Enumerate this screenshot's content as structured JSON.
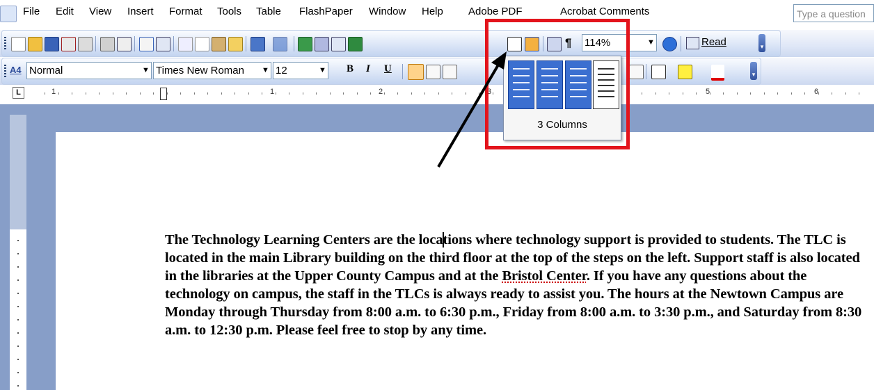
{
  "menubar": {
    "items": [
      "File",
      "Edit",
      "View",
      "Insert",
      "Format",
      "Tools",
      "Table",
      "FlashPaper",
      "Window",
      "Help",
      "Adobe PDF",
      "Acrobat Comments"
    ],
    "help_placeholder": "Type a question"
  },
  "formatting": {
    "style": "Normal",
    "font": "Times New Roman",
    "size": "12",
    "bold": "B",
    "italic": "I",
    "underline": "U"
  },
  "standard": {
    "zoom": "114%",
    "read_label": "Read"
  },
  "ruler": {
    "tab_selector": "L",
    "numbers": [
      "1",
      "1",
      "2",
      "3",
      "5",
      "6"
    ]
  },
  "columns_popup": {
    "label": "3 Columns",
    "selected_count": 3
  },
  "document": {
    "text_before_cursor": "The Technology Learning Centers are the loca",
    "text_after_cursor": "tions where technology support is provided to students. The TLC is located in the main Library building on the third floor at the top of the steps on the left.  Support staff is also located in the libraries at the Upper County Campus and at the ",
    "squiggle": "Bristol Center",
    "text_end": ". If you have any questions about the technology on campus, the staff in the TLCs is always ready to assist you. The hours at the Newtown Campus are Monday through Thursday from 8:00 a.m. to 6:30 p.m., Friday from 8:00 a.m. to 3:30 p.m., and Saturday from 8:30 a.m. to 12:30 p.m.  Please feel free to stop by any time."
  },
  "colors": {
    "annotation": "#e3141c",
    "selected_column": "#3b6fd0",
    "workspace": "#879ec8"
  }
}
